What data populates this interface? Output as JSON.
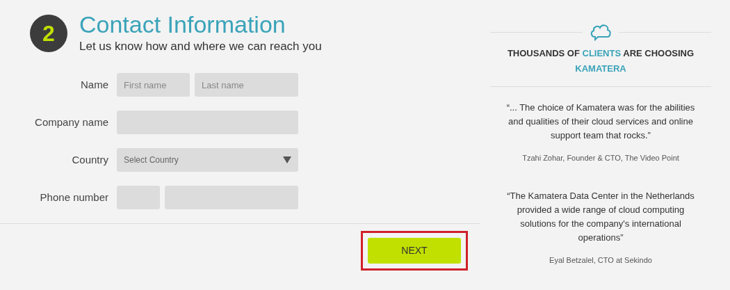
{
  "step": {
    "number": "2",
    "title": "Contact Information",
    "subtitle": "Let us know how and where we can reach you"
  },
  "form": {
    "fields": [
      {
        "label": "Name",
        "kind": "split",
        "inputs": [
          {
            "placeholder": "First name"
          },
          {
            "placeholder": "Last name"
          }
        ]
      },
      {
        "label": "Company name",
        "kind": "text"
      },
      {
        "label": "Country",
        "kind": "select",
        "inputs": [
          {
            "placeholder": "Select Country"
          }
        ]
      },
      {
        "label": "Phone number",
        "kind": "phone"
      }
    ],
    "submit": {
      "label": "NEXT",
      "highlighted": true
    }
  },
  "sidebar": {
    "headline": [
      {
        "text": "THOUSANDS OF ",
        "highlight": false
      },
      {
        "text": "CLIENTS",
        "highlight": true
      },
      {
        "text": " ARE CHOOSING ",
        "highlight": false
      },
      {
        "text": "KAMATERA",
        "highlight": true
      }
    ],
    "testimonials": [
      {
        "quote": "“... The choice of Kamatera was for the abilities and qualities of their cloud services and online support team that rocks.”",
        "author": "Tzahi Zohar, Founder & CTO, The Video Point"
      },
      {
        "quote": "“The Kamatera Data Center in the Netherlands provided a wide range of cloud computing solutions for the company's international operations”",
        "author": "Eyal Betzalel, CTO at Sekindo"
      }
    ]
  }
}
